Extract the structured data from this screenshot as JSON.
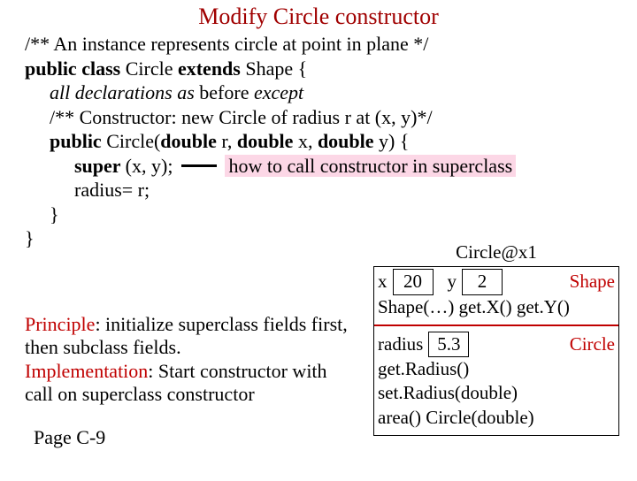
{
  "title": "Modify Circle constructor",
  "code": {
    "line1": "/** An instance represents circle at point in plane */",
    "line2_pre": "public class ",
    "line2_mid": "Circle ",
    "line2_ext": "extends ",
    "line2_end": "Shape {",
    "line3_a": "all declarations as ",
    "line3_b": "before",
    "line3_c": " except",
    "line4": "/** Constructor: new Circle of radius r at (x, y)*/",
    "line5_a": "public ",
    "line5_b": "Circle(",
    "line5_c": "double ",
    "line5_d": "r, ",
    "line5_e": "double ",
    "line5_f": "x, ",
    "line5_g": "double ",
    "line5_h": "y) {",
    "line6_a": "super ",
    "line6_b": "(x, y);",
    "line6_note": "how to call constructor in superclass",
    "line7": "radius= r;",
    "line8": "}",
    "line9": "}"
  },
  "note": {
    "p1_label": "Principle",
    "p1_text": ": initialize superclass fields first, then subclass fields.",
    "p2_label": "Implementation",
    "p2_text": ": Start constructor with call on superclass constructor"
  },
  "page_ref": "Page C-9",
  "obj": {
    "id": "Circle@x1",
    "x_label": "x",
    "x_val": "20",
    "y_label": "y",
    "y_val": "2",
    "tag_shape": "Shape",
    "shape_methods": "Shape(…)  get.X()  get.Y()",
    "radius_label": "radius",
    "radius_val": "5.3",
    "tag_circle": "Circle",
    "m1": "get.Radius()",
    "m2": "set.Radius(double)",
    "m3": "area()  Circle(double)"
  }
}
